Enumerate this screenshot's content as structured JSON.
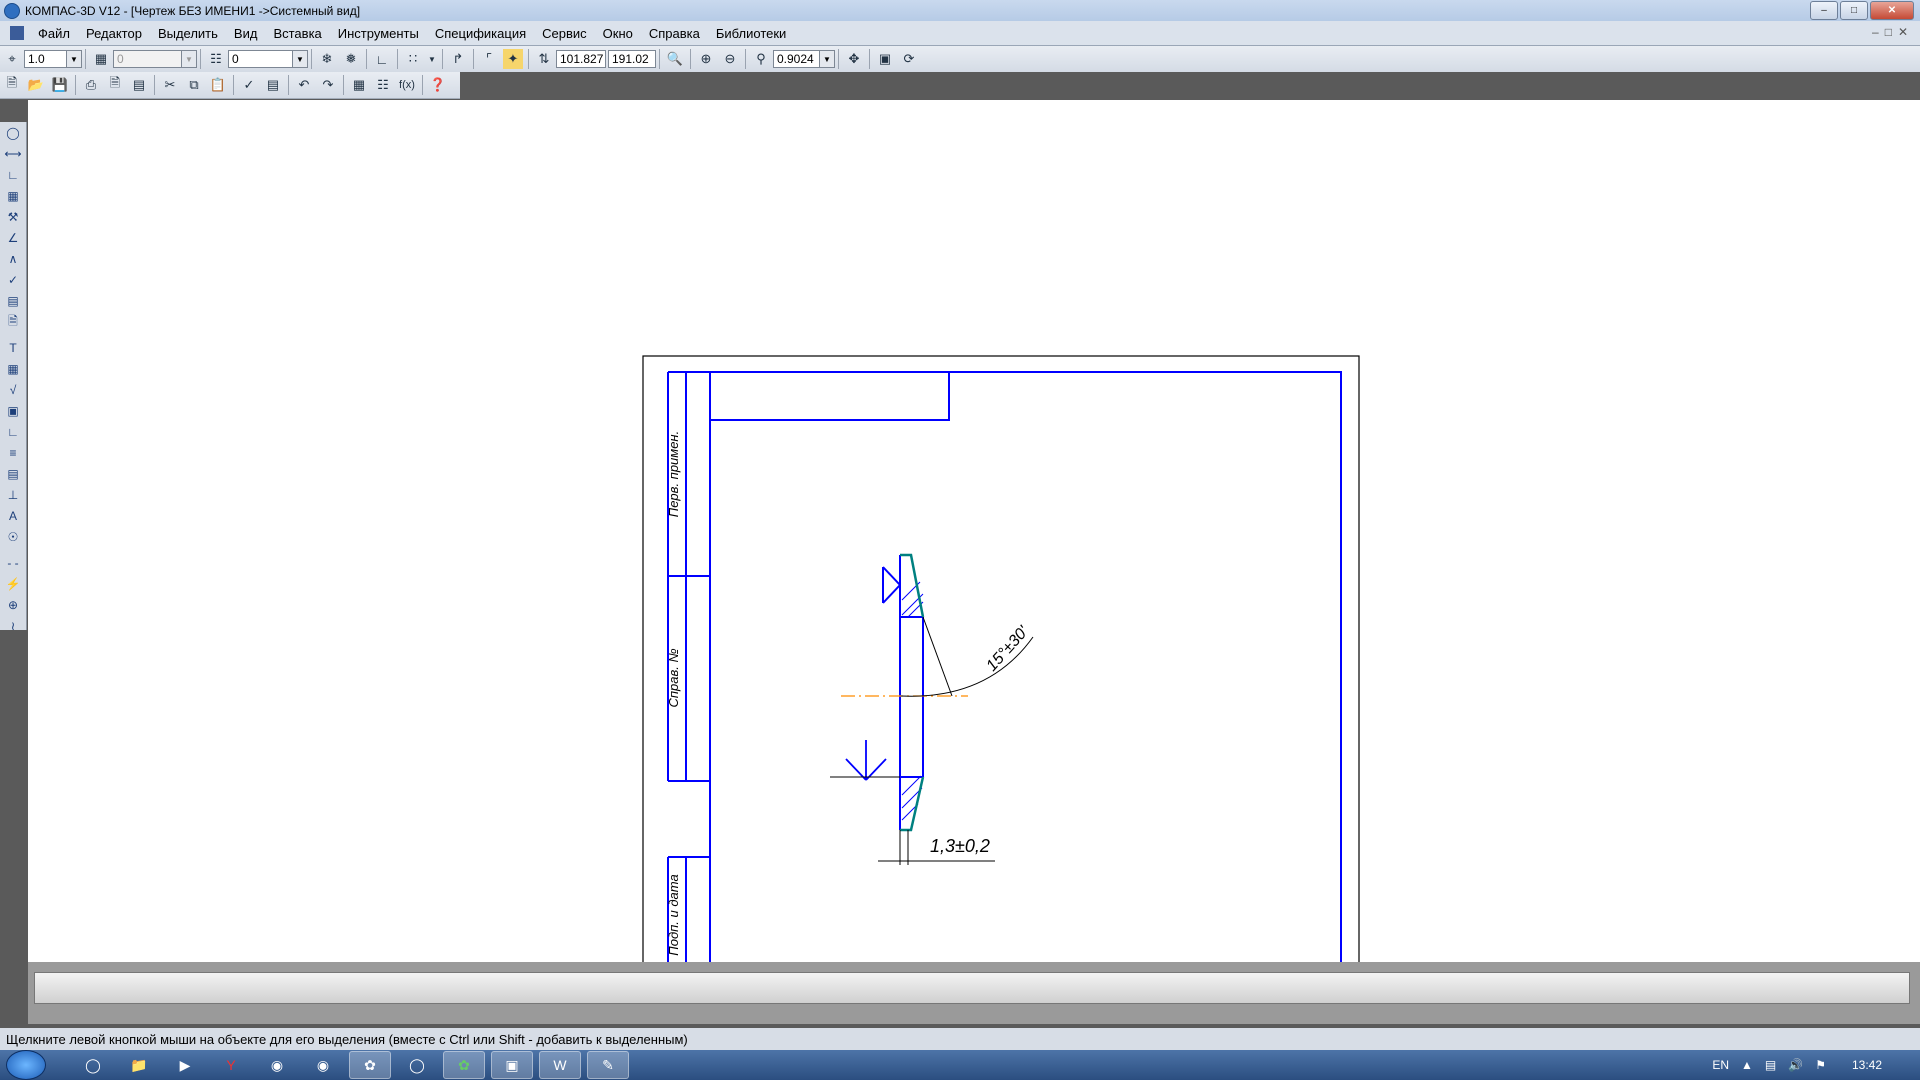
{
  "window": {
    "title": "КОМПАС-3D V12 - [Чертеж БЕЗ ИМЕНИ1 ->Системный вид]"
  },
  "menu": [
    "Файл",
    "Редактор",
    "Выделить",
    "Вид",
    "Вставка",
    "Инструменты",
    "Спецификация",
    "Сервис",
    "Окно",
    "Справка",
    "Библиотеки"
  ],
  "toolbar": {
    "scale_value": "1.0",
    "style_value": "0",
    "layer_value": "0",
    "coord_x": "101.827",
    "coord_y": "191.02",
    "zoom_value": "0.9024"
  },
  "drawing": {
    "stamp_labels": [
      "Перв. примен.",
      "Справ. №",
      "Подп. и дата"
    ],
    "dim_angle": "15°±30'",
    "dim_thickness": "1,3±0,2",
    "line_color": "#0000ff",
    "hatch_color": "#008080",
    "axis_color": "#ff8c00"
  },
  "status": {
    "hint": "Щелкните левой кнопкой мыши на объекте для его выделения (вместе с Ctrl или Shift - добавить к выделенным)"
  },
  "tray": {
    "lang": "EN",
    "time": "13:42"
  }
}
